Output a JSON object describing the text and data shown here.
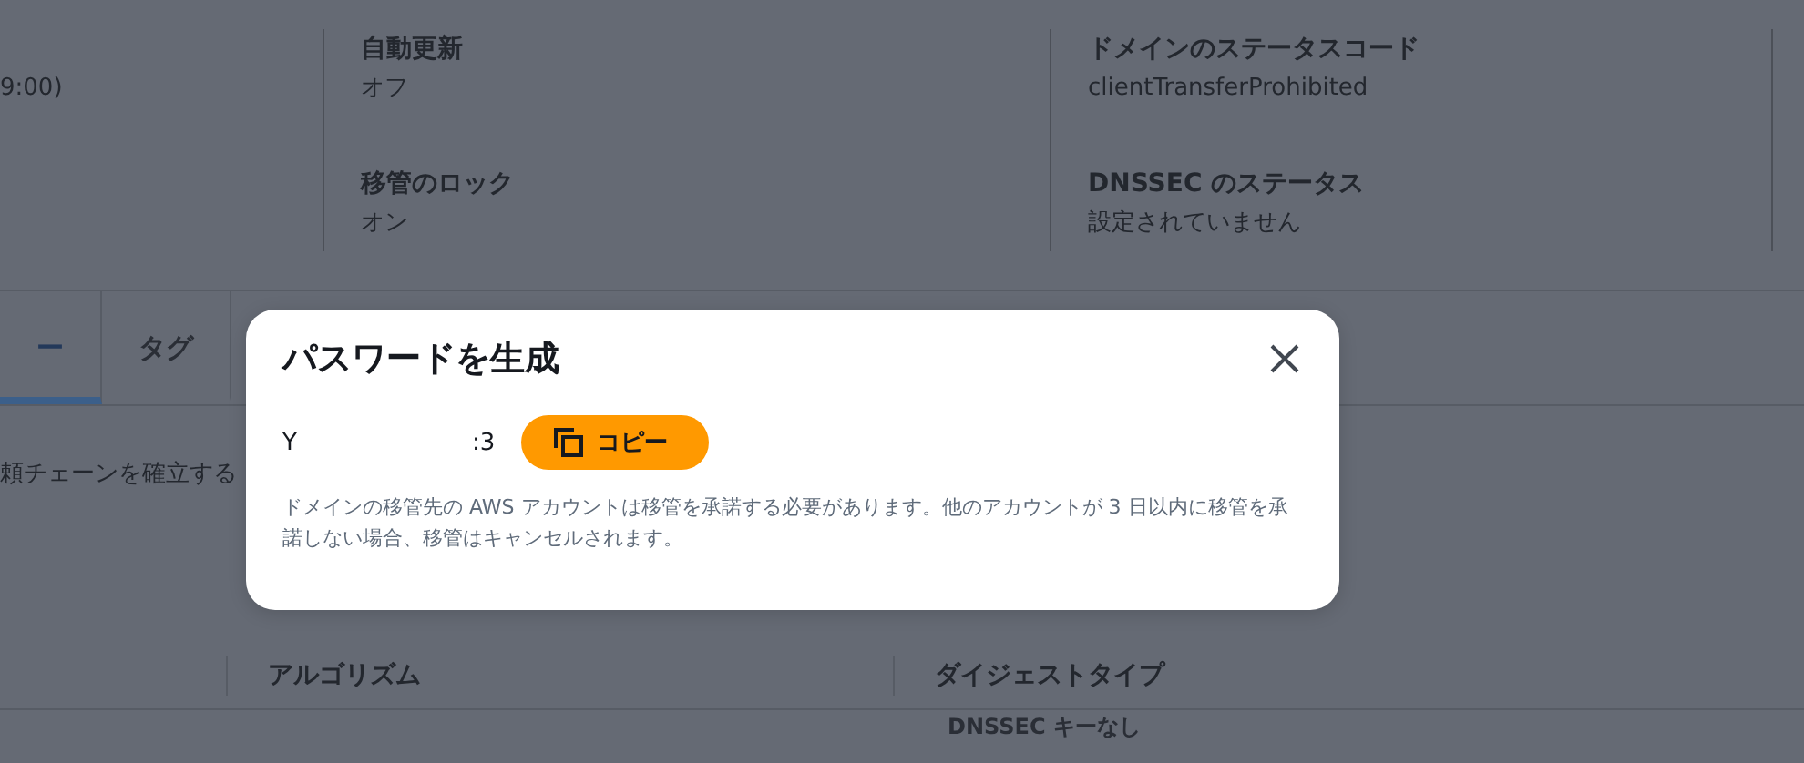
{
  "details": {
    "column_1": [
      {
        "value": "9:00)"
      }
    ],
    "column_2": [
      {
        "label": "自動更新",
        "value": "オフ"
      },
      {
        "label": "移管のロック",
        "value": "オン"
      }
    ],
    "column_3": [
      {
        "label": "ドメインのステータスコード",
        "value": "clientTransferProhibited"
      },
      {
        "label": "DNSSEC のステータス",
        "value": "設定されていません"
      }
    ]
  },
  "tabs": [
    {
      "label": "ー",
      "selected": true
    },
    {
      "label": "タグ",
      "selected": false
    }
  ],
  "section_text": "頼チェーンを確立する",
  "table": {
    "columns": [
      "アルゴリズム",
      "ダイジェストタイプ"
    ],
    "empty_message": "DNSSEC キーなし"
  },
  "modal": {
    "title": "パスワードを生成",
    "password_start": "Y",
    "password_end": ":3",
    "copy_button": "コピー",
    "description": "ドメインの移管先の AWS アカウントは移管を承諾する必要があります。他のアカウントが 3 日以内に移管を承諾しない場合、移管はキャンセルされます。"
  }
}
